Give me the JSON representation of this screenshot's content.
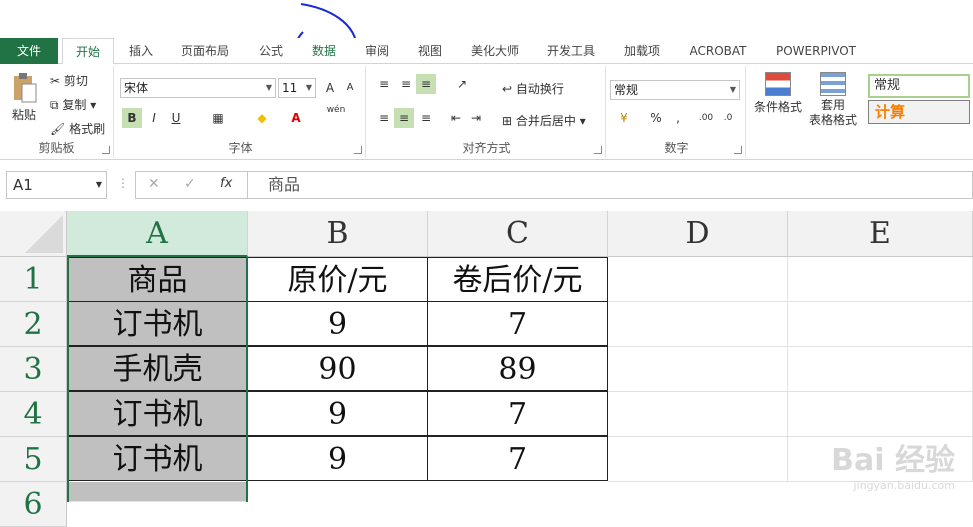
{
  "tabs": [
    "文件",
    "开始",
    "插入",
    "页面布局",
    "公式",
    "数据",
    "审阅",
    "视图",
    "美化大师",
    "开发工具",
    "加载项",
    "ACROBAT",
    "POWERPIVOT"
  ],
  "ribbon": {
    "clipboard": {
      "paste": "粘贴",
      "cut": "剪切",
      "copy": "复制",
      "format_painter": "格式刷",
      "label": "剪贴板"
    },
    "font": {
      "name": "宋体",
      "size": "11",
      "bold": "B",
      "italic": "I",
      "underline": "U",
      "label": "字体",
      "grow": "A",
      "shrink": "A",
      "phonetic": "wén"
    },
    "alignment": {
      "wrap": "自动换行",
      "merge": "合并后居中",
      "label": "对齐方式"
    },
    "number": {
      "format": "常规",
      "percent": "%",
      "comma": ",",
      "inc_dec": ".00",
      "dec_dec": ".0",
      "label": "数字"
    },
    "styles": {
      "conditional": "条件格式",
      "table_fmt_1": "套用",
      "table_fmt_2": "表格格式",
      "style_normal": "常规",
      "style_calc": "计算"
    }
  },
  "formula_bar": {
    "name_box": "A1",
    "fx": "fx",
    "content": "商品"
  },
  "columns": [
    "A",
    "B",
    "C",
    "D",
    "E"
  ],
  "rows": [
    "1",
    "2",
    "3",
    "4",
    "5",
    "6"
  ],
  "cells": [
    [
      "商品",
      "原价/元",
      "卷后价/元"
    ],
    [
      "订书机",
      "9",
      "7"
    ],
    [
      "手机壳",
      "90",
      "89"
    ],
    [
      "订书机",
      "9",
      "7"
    ],
    [
      "订书机",
      "9",
      "7"
    ]
  ],
  "watermark": {
    "brand": "Bai 经验",
    "url": "jingyan.baidu.com"
  },
  "colors": {
    "accent": "#217346",
    "selected_col": "#d2eadb",
    "cell_gray": "#c0c0c0",
    "ring": "#1a2bd6"
  }
}
